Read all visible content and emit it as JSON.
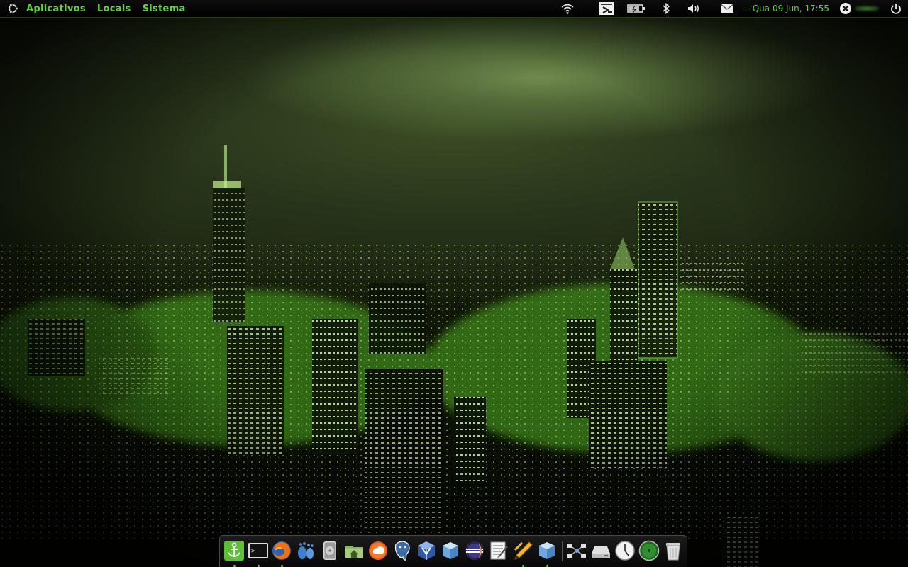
{
  "panel": {
    "menus": [
      "Aplicativos",
      "Locais",
      "Sistema"
    ],
    "clock": "-- Qua 09 Jun, 17:55"
  },
  "tray_icons": [
    "wifi-icon",
    "display-icon",
    "battery-icon",
    "bluetooth-icon",
    "volume-icon",
    "mail-icon",
    "user-close-icon",
    "power-icon"
  ],
  "dock_icons": [
    "anchor-icon",
    "terminal-icon",
    "firefox-icon",
    "gnome-foot-icon",
    "disk-icon",
    "home-folder-icon",
    "ubuntu-one-icon",
    "postgresql-icon",
    "virtualbox-icon",
    "cube-icon",
    "eclipse-icon",
    "text-editor-icon",
    "pencil-icon",
    "cube-icon",
    "network-icon",
    "drive-icon",
    "clock-icon",
    "globe-icon",
    "trash-icon"
  ],
  "colors": {
    "panel_text": "#5fd43a",
    "accent_green": "#6fe040"
  }
}
